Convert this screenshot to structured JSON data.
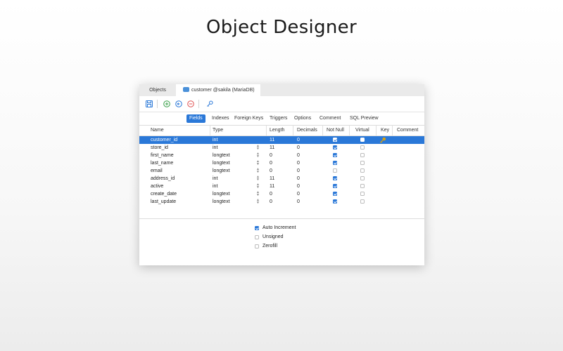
{
  "hero": {
    "title": "Object Designer"
  },
  "tabs": {
    "objects": "Objects",
    "active": "customer @sakila (MariaDB)"
  },
  "subtabs": [
    "Fields",
    "Indexes",
    "Foreign Keys",
    "Triggers",
    "Options",
    "Comment",
    "SQL Preview"
  ],
  "selected_subtab": "Fields",
  "columns": [
    "Name",
    "Type",
    "Length",
    "Decimals",
    "Not Null",
    "Virtual",
    "Key",
    "Comment"
  ],
  "rows": [
    {
      "name": "customer_id",
      "type": "int",
      "length": "11",
      "decimals": "0",
      "not_null": true,
      "virtual": false,
      "key": true
    },
    {
      "name": "store_id",
      "type": "int",
      "length": "11",
      "decimals": "0",
      "not_null": true,
      "virtual": false,
      "key": false
    },
    {
      "name": "first_name",
      "type": "longtext",
      "length": "0",
      "decimals": "0",
      "not_null": true,
      "virtual": false,
      "key": false
    },
    {
      "name": "last_name",
      "type": "longtext",
      "length": "0",
      "decimals": "0",
      "not_null": true,
      "virtual": false,
      "key": false
    },
    {
      "name": "email",
      "type": "longtext",
      "length": "0",
      "decimals": "0",
      "not_null": false,
      "virtual": false,
      "key": false
    },
    {
      "name": "address_id",
      "type": "int",
      "length": "11",
      "decimals": "0",
      "not_null": true,
      "virtual": false,
      "key": false
    },
    {
      "name": "active",
      "type": "int",
      "length": "11",
      "decimals": "0",
      "not_null": true,
      "virtual": false,
      "key": false
    },
    {
      "name": "create_date",
      "type": "longtext",
      "length": "0",
      "decimals": "0",
      "not_null": true,
      "virtual": false,
      "key": false
    },
    {
      "name": "last_update",
      "type": "longtext",
      "length": "0",
      "decimals": "0",
      "not_null": true,
      "virtual": false,
      "key": false
    }
  ],
  "selected_row": 0,
  "options": [
    {
      "label": "Auto Increment",
      "checked": true
    },
    {
      "label": "Unsigned",
      "checked": false
    },
    {
      "label": "Zerofill",
      "checked": false
    }
  ],
  "colors": {
    "accent": "#2a78d8",
    "key": "#d4a017"
  }
}
